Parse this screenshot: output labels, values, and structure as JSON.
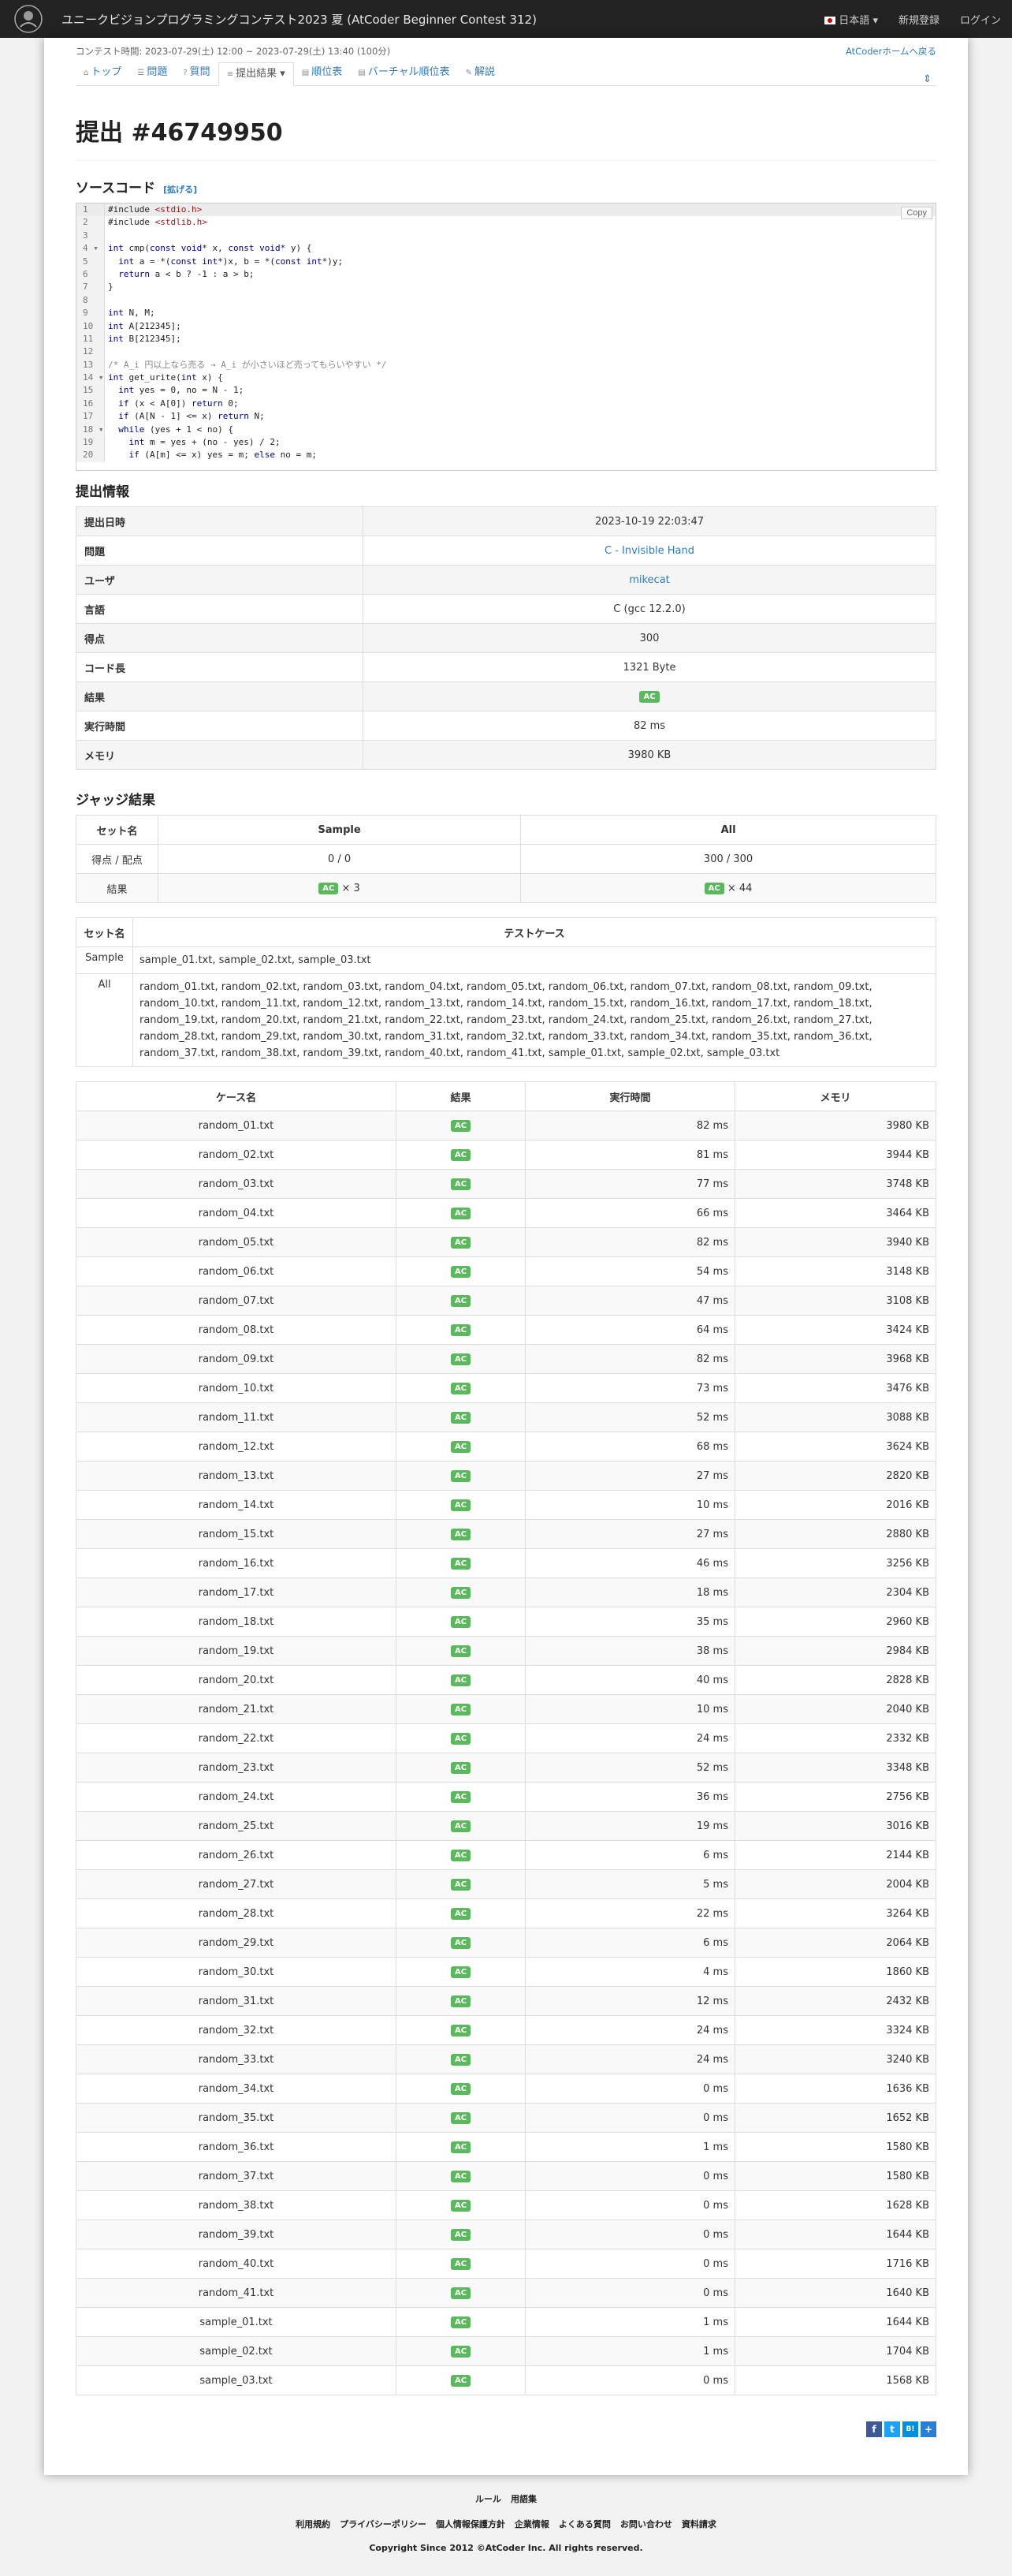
{
  "navbar": {
    "contest_title": "ユニークビジョンプログラミングコンテスト2023 夏 (AtCoder Beginner Contest 312)",
    "logo_text": "AtCoder",
    "language": "日本語",
    "signup": "新規登録",
    "login": "ログイン"
  },
  "contest_bar": {
    "time": "コンテスト時間: 2023-07-29(土) 12:00 ~ 2023-07-29(土) 13:40 (100分)",
    "home_link": "AtCoderホームへ戻る"
  },
  "tabs": [
    {
      "label": "トップ",
      "icon": "home-icon"
    },
    {
      "label": "問題",
      "icon": "tasks-icon"
    },
    {
      "label": "質問",
      "icon": "question-icon"
    },
    {
      "label": "提出結果",
      "icon": "submissions-icon",
      "active": true
    },
    {
      "label": "順位表",
      "icon": "standings-icon"
    },
    {
      "label": "バーチャル順位表",
      "icon": "virtual-standings-icon"
    },
    {
      "label": "解説",
      "icon": "editorial-icon"
    }
  ],
  "page_title": "提出 #46749950",
  "source": {
    "heading": "ソースコード",
    "expand": "[拡げる]",
    "copy": "Copy",
    "lines": [
      "#include <stdio.h>",
      "#include <stdlib.h>",
      "",
      "int cmp(const void* x, const void* y) {",
      "  int a = *(const int*)x, b = *(const int*)y;",
      "  return a < b ? -1 : a > b;",
      "}",
      "",
      "int N, M;",
      "int A[212345];",
      "int B[212345];",
      "",
      "/* A_i 円以上なら売る → A_i が小さいほど売ってもらいやすい */",
      "int get_urite(int x) {",
      "  int yes = 0, no = N - 1;",
      "  if (x < A[0]) return 0;",
      "  if (A[N - 1] <= x) return N;",
      "  while (yes + 1 < no) {",
      "    int m = yes + (no - yes) / 2;",
      "    if (A[m] <= x) yes = m; else no = m;"
    ]
  },
  "info": {
    "heading": "提出情報",
    "rows": [
      {
        "label": "提出日時",
        "value": "2023-10-19 22:03:47"
      },
      {
        "label": "問題",
        "value": "C - Invisible Hand",
        "link": true
      },
      {
        "label": "ユーザ",
        "value": "mikecat",
        "link": true
      },
      {
        "label": "言語",
        "value": "C (gcc 12.2.0)"
      },
      {
        "label": "得点",
        "value": "300"
      },
      {
        "label": "コード長",
        "value": "1321 Byte"
      },
      {
        "label": "結果",
        "value": "AC",
        "badge": true
      },
      {
        "label": "実行時間",
        "value": "82 ms"
      },
      {
        "label": "メモリ",
        "value": "3980 KB"
      }
    ]
  },
  "judge": {
    "heading": "ジャッジ結果",
    "headers": [
      "セット名",
      "Sample",
      "All"
    ],
    "score_label": "得点 / 配点",
    "scores": [
      "0 / 0",
      "300 / 300"
    ],
    "result_label": "結果",
    "results": [
      "× 3",
      "× 44"
    ],
    "badge": "AC"
  },
  "sets": {
    "headers": [
      "セット名",
      "テストケース"
    ],
    "rows": [
      {
        "name": "Sample",
        "cases": "sample_01.txt, sample_02.txt, sample_03.txt"
      },
      {
        "name": "All",
        "cases": "random_01.txt, random_02.txt, random_03.txt, random_04.txt, random_05.txt, random_06.txt, random_07.txt, random_08.txt, random_09.txt, random_10.txt, random_11.txt, random_12.txt, random_13.txt, random_14.txt, random_15.txt, random_16.txt, random_17.txt, random_18.txt, random_19.txt, random_20.txt, random_21.txt, random_22.txt, random_23.txt, random_24.txt, random_25.txt, random_26.txt, random_27.txt, random_28.txt, random_29.txt, random_30.txt, random_31.txt, random_32.txt, random_33.txt, random_34.txt, random_35.txt, random_36.txt, random_37.txt, random_38.txt, random_39.txt, random_40.txt, random_41.txt, sample_01.txt, sample_02.txt, sample_03.txt"
      }
    ]
  },
  "cases": {
    "headers": [
      "ケース名",
      "結果",
      "実行時間",
      "メモリ"
    ],
    "rows": [
      [
        "random_01.txt",
        "AC",
        "82 ms",
        "3980 KB"
      ],
      [
        "random_02.txt",
        "AC",
        "81 ms",
        "3944 KB"
      ],
      [
        "random_03.txt",
        "AC",
        "77 ms",
        "3748 KB"
      ],
      [
        "random_04.txt",
        "AC",
        "66 ms",
        "3464 KB"
      ],
      [
        "random_05.txt",
        "AC",
        "82 ms",
        "3940 KB"
      ],
      [
        "random_06.txt",
        "AC",
        "54 ms",
        "3148 KB"
      ],
      [
        "random_07.txt",
        "AC",
        "47 ms",
        "3108 KB"
      ],
      [
        "random_08.txt",
        "AC",
        "64 ms",
        "3424 KB"
      ],
      [
        "random_09.txt",
        "AC",
        "82 ms",
        "3968 KB"
      ],
      [
        "random_10.txt",
        "AC",
        "73 ms",
        "3476 KB"
      ],
      [
        "random_11.txt",
        "AC",
        "52 ms",
        "3088 KB"
      ],
      [
        "random_12.txt",
        "AC",
        "68 ms",
        "3624 KB"
      ],
      [
        "random_13.txt",
        "AC",
        "27 ms",
        "2820 KB"
      ],
      [
        "random_14.txt",
        "AC",
        "10 ms",
        "2016 KB"
      ],
      [
        "random_15.txt",
        "AC",
        "27 ms",
        "2880 KB"
      ],
      [
        "random_16.txt",
        "AC",
        "46 ms",
        "3256 KB"
      ],
      [
        "random_17.txt",
        "AC",
        "18 ms",
        "2304 KB"
      ],
      [
        "random_18.txt",
        "AC",
        "35 ms",
        "2960 KB"
      ],
      [
        "random_19.txt",
        "AC",
        "38 ms",
        "2984 KB"
      ],
      [
        "random_20.txt",
        "AC",
        "40 ms",
        "2828 KB"
      ],
      [
        "random_21.txt",
        "AC",
        "10 ms",
        "2040 KB"
      ],
      [
        "random_22.txt",
        "AC",
        "24 ms",
        "2332 KB"
      ],
      [
        "random_23.txt",
        "AC",
        "52 ms",
        "3348 KB"
      ],
      [
        "random_24.txt",
        "AC",
        "36 ms",
        "2756 KB"
      ],
      [
        "random_25.txt",
        "AC",
        "19 ms",
        "3016 KB"
      ],
      [
        "random_26.txt",
        "AC",
        "6 ms",
        "2144 KB"
      ],
      [
        "random_27.txt",
        "AC",
        "5 ms",
        "2004 KB"
      ],
      [
        "random_28.txt",
        "AC",
        "22 ms",
        "3264 KB"
      ],
      [
        "random_29.txt",
        "AC",
        "6 ms",
        "2064 KB"
      ],
      [
        "random_30.txt",
        "AC",
        "4 ms",
        "1860 KB"
      ],
      [
        "random_31.txt",
        "AC",
        "12 ms",
        "2432 KB"
      ],
      [
        "random_32.txt",
        "AC",
        "24 ms",
        "3324 KB"
      ],
      [
        "random_33.txt",
        "AC",
        "24 ms",
        "3240 KB"
      ],
      [
        "random_34.txt",
        "AC",
        "0 ms",
        "1636 KB"
      ],
      [
        "random_35.txt",
        "AC",
        "0 ms",
        "1652 KB"
      ],
      [
        "random_36.txt",
        "AC",
        "1 ms",
        "1580 KB"
      ],
      [
        "random_37.txt",
        "AC",
        "0 ms",
        "1580 KB"
      ],
      [
        "random_38.txt",
        "AC",
        "0 ms",
        "1628 KB"
      ],
      [
        "random_39.txt",
        "AC",
        "0 ms",
        "1644 KB"
      ],
      [
        "random_40.txt",
        "AC",
        "0 ms",
        "1716 KB"
      ],
      [
        "random_41.txt",
        "AC",
        "0 ms",
        "1640 KB"
      ],
      [
        "sample_01.txt",
        "AC",
        "1 ms",
        "1644 KB"
      ],
      [
        "sample_02.txt",
        "AC",
        "1 ms",
        "1704 KB"
      ],
      [
        "sample_03.txt",
        "AC",
        "0 ms",
        "1568 KB"
      ]
    ]
  },
  "share": [
    "f",
    "t",
    "B!",
    "+"
  ],
  "footer": {
    "row1": [
      "ルール",
      "用語集"
    ],
    "row2": [
      "利用規約",
      "プライバシーポリシー",
      "個人情報保護方針",
      "企業情報",
      "よくある質問",
      "お問い合わせ",
      "資料請求"
    ],
    "copyright_prefix": "Copyright Since 2012 ©",
    "copyright_company": "AtCoder Inc.",
    "copyright_suffix": " All rights reserved."
  },
  "colors": {
    "navbar": "#222222",
    "accent": "#337ab7",
    "ac_badge": "#5cb85c"
  }
}
